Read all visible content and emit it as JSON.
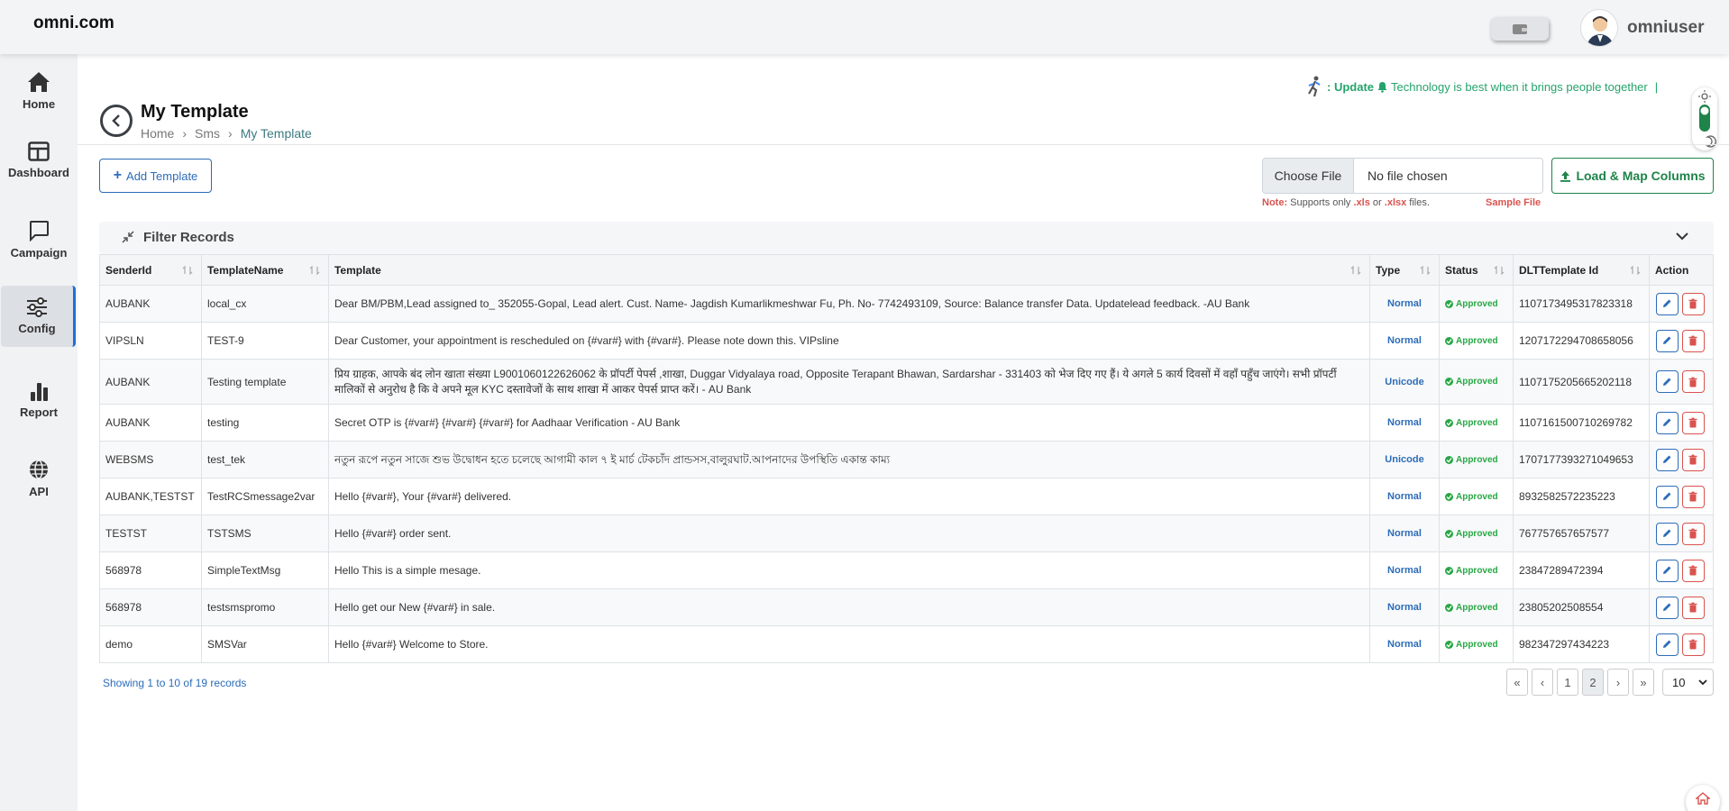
{
  "app": {
    "logo": "omni.com",
    "username": "omniuser"
  },
  "sidebar": {
    "items": [
      {
        "label": "Home",
        "icon": "home-icon"
      },
      {
        "label": "Dashboard",
        "icon": "dashboard-icon"
      },
      {
        "label": "Campaign",
        "icon": "chat-icon"
      },
      {
        "label": "Config",
        "icon": "sliders-icon",
        "active": true
      },
      {
        "label": "Report",
        "icon": "bar-chart-icon"
      },
      {
        "label": "API",
        "icon": "globe-icon"
      }
    ]
  },
  "ticker": {
    "prefix": ": Update",
    "text": "Technology is best when it brings people together"
  },
  "page": {
    "title": "My Template",
    "breadcrumb": [
      "Home",
      "Sms",
      "My Template"
    ]
  },
  "toolbar": {
    "add_label": "Add Template",
    "choose_file": "Choose File",
    "no_file": "No file chosen",
    "load_label": "Load & Map Columns",
    "note_label": "Note:",
    "note_a": "Supports only",
    "ext_xls": ".xls",
    "note_or": "or",
    "ext_xlsx": ".xlsx",
    "note_b": "files.",
    "sample_file": "Sample File"
  },
  "filter": {
    "title": "Filter Records"
  },
  "table": {
    "headers": [
      "SenderId",
      "TemplateName",
      "Template",
      "Type",
      "Status",
      "DLTTemplate Id",
      "Action"
    ],
    "rows": [
      {
        "sender": "AUBANK",
        "name": "local_cx",
        "template": "Dear BM/PBM,Lead assigned to_ 352055-Gopal, Lead alert. Cust. Name- Jagdish Kumarlikmeshwar Fu, Ph. No- 7742493109, Source: Balance transfer Data. Updatelead feedback. -AU Bank",
        "type": "Normal",
        "status": "Approved",
        "dlt": "1107173495317823318"
      },
      {
        "sender": "VIPSLN",
        "name": "TEST-9",
        "template": "Dear Customer, your appointment is rescheduled on {#var#} with {#var#}. Please note down this. VIPsline",
        "type": "Normal",
        "status": "Approved",
        "dlt": "1207172294708658056"
      },
      {
        "sender": "AUBANK",
        "name": "Testing template",
        "template": "प्रिय ग्राहक, आपके बंद लोन खाता संख्या L9001060122626062 के प्रॉपर्टी पेपर्स ,शाखा, Duggar Vidyalaya road, Opposite Terapant Bhawan, Sardarshar - 331403 को भेज दिए गए हैं। ये अगले 5 कार्य दिवसों में वहाँ पहुँच जाएंगे। सभी प्रॉपर्टी मालिकों से अनुरोध है कि वे अपने मूल KYC दस्तावेजों के साथ शाखा में आकर पेपर्स प्राप्त करें। - AU Bank",
        "type": "Unicode",
        "status": "Approved",
        "dlt": "1107175205665202118"
      },
      {
        "sender": "AUBANK",
        "name": "testing",
        "template": "Secret OTP is {#var#} {#var#} {#var#} for Aadhaar Verification - AU Bank",
        "type": "Normal",
        "status": "Approved",
        "dlt": "1107161500710269782"
      },
      {
        "sender": "WEBSMS",
        "name": "test_tek",
        "template": "নতুন রূপে নতুন সাজে শুভ উদ্বোধন হতে চলেছে আগামী কাল ৭ ই মার্চ টেকচাঁদ প্রান্ডসস,বালুরঘাট.আপনাদের উপস্থিতি একান্ত কাম্য",
        "type": "Unicode",
        "status": "Approved",
        "dlt": "1707177393271049653"
      },
      {
        "sender": "AUBANK,TESTST",
        "name": "TestRCSmessage2var",
        "template": "Hello {#var#}, Your {#var#} delivered.",
        "type": "Normal",
        "status": "Approved",
        "dlt": "8932582572235223"
      },
      {
        "sender": "TESTST",
        "name": "TSTSMS",
        "template": "Hello {#var#} order sent.",
        "type": "Normal",
        "status": "Approved",
        "dlt": "767757657657577"
      },
      {
        "sender": "568978",
        "name": "SimpleTextMsg",
        "template": "Hello This is a simple mesage.",
        "type": "Normal",
        "status": "Approved",
        "dlt": "23847289472394"
      },
      {
        "sender": "568978",
        "name": "testsmspromo",
        "template": "Hello get our New {#var#} in sale.",
        "type": "Normal",
        "status": "Approved",
        "dlt": "23805202508554"
      },
      {
        "sender": "demo",
        "name": "SMSVar",
        "template": "Hello {#var#} Welcome to Store.",
        "type": "Normal",
        "status": "Approved",
        "dlt": "982347297434223"
      }
    ]
  },
  "footer": {
    "showing": "Showing 1 to 10 of 19 records",
    "pages": [
      "«",
      "‹",
      "1",
      "2",
      "›",
      "»"
    ],
    "page_size": "10"
  }
}
